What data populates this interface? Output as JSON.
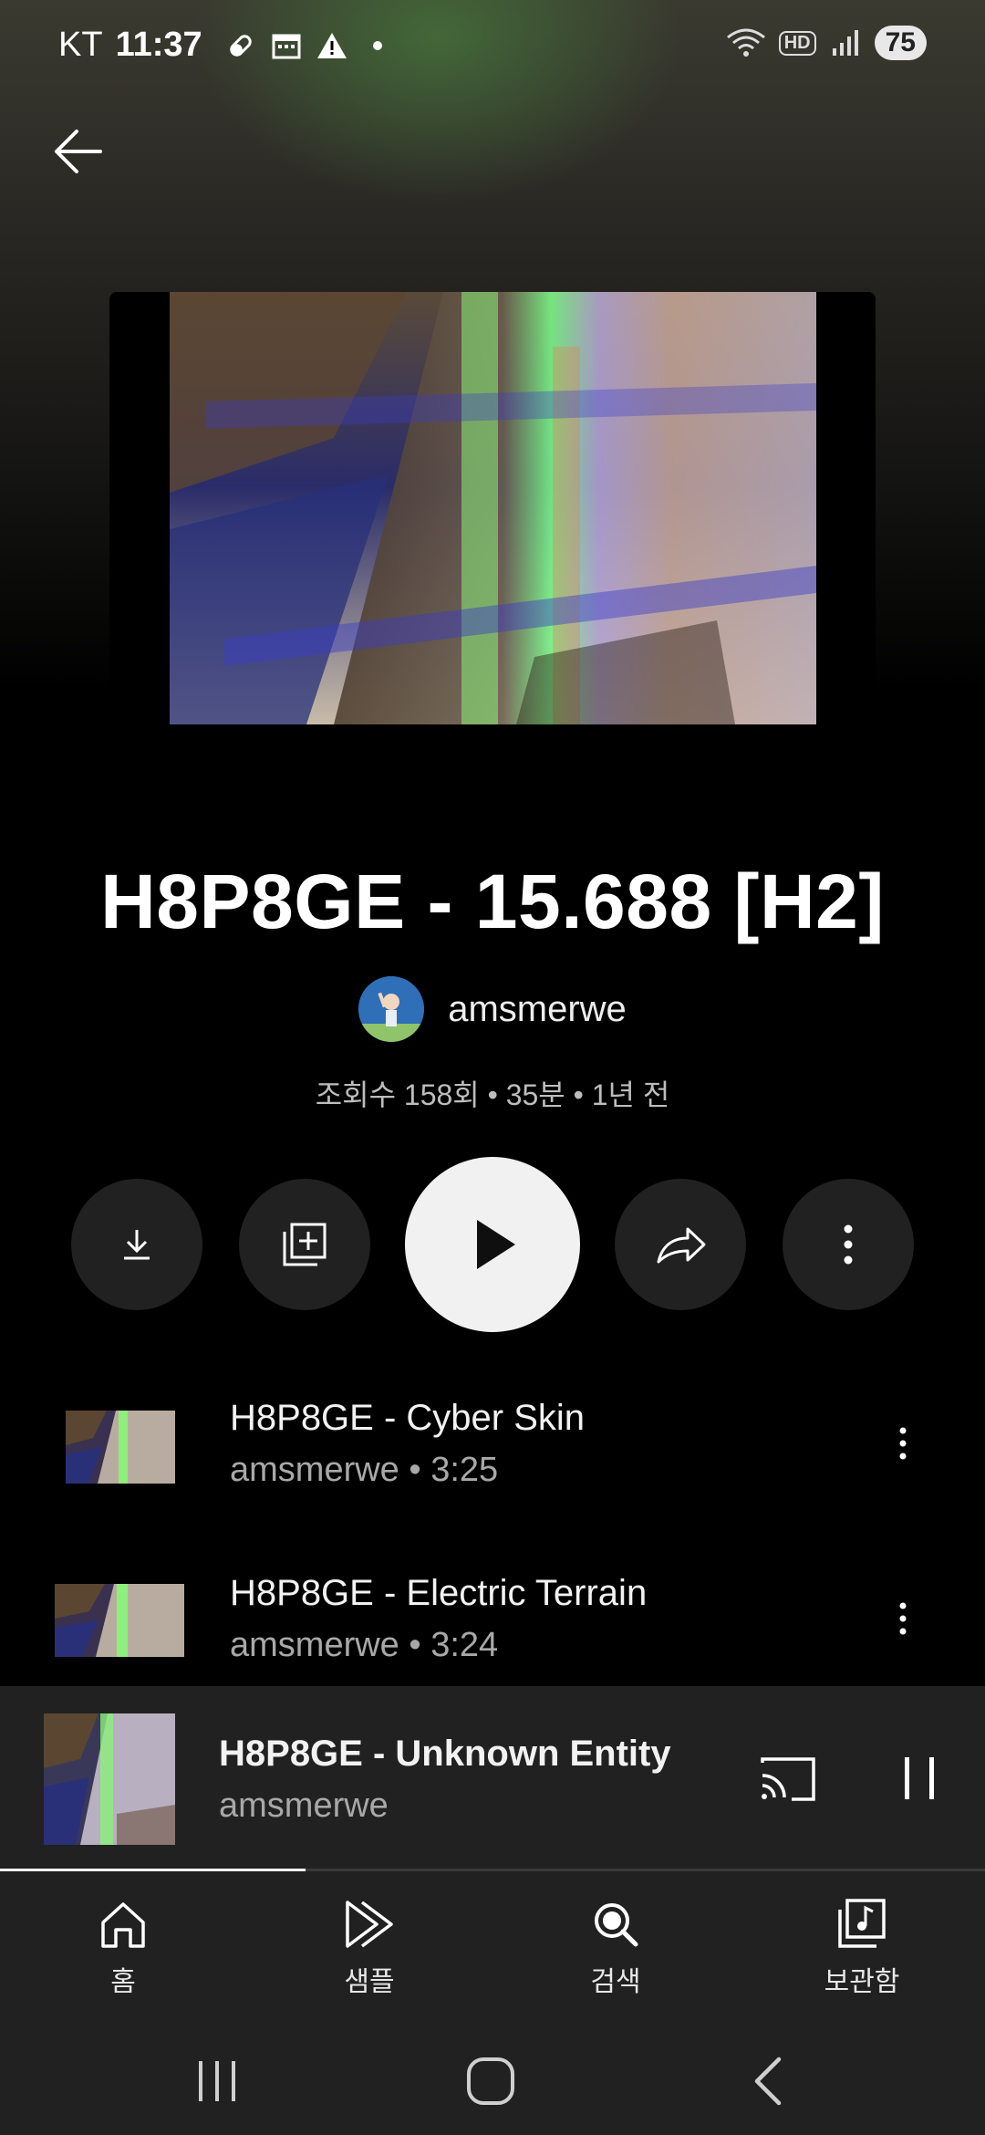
{
  "status_bar": {
    "carrier": "KT",
    "time": "11:37",
    "battery": "75",
    "hd_label": "HD"
  },
  "album": {
    "title": "H8P8GE - 15.688 [H2]",
    "channel": "amsmerwe",
    "meta": "조회수 158회 • 35분 • 1년 전"
  },
  "actions": {
    "download": "download-icon",
    "save": "add-to-playlist-icon",
    "play": "play-icon",
    "share": "share-icon",
    "more": "more-vert-icon"
  },
  "tracks": [
    {
      "title": "H8P8GE - Cyber Skin",
      "subtitle": "amsmerwe • 3:25"
    },
    {
      "title": "H8P8GE - Electric Terrain",
      "subtitle": "amsmerwe • 3:24"
    }
  ],
  "mini_player": {
    "title": "H8P8GE - Unknown Entity",
    "artist": "amsmerwe",
    "progress": 0.31
  },
  "bottom_nav": [
    {
      "label": "홈",
      "icon": "home-icon"
    },
    {
      "label": "샘플",
      "icon": "samples-icon"
    },
    {
      "label": "검색",
      "icon": "search-icon"
    },
    {
      "label": "보관함",
      "icon": "library-icon"
    }
  ],
  "colors": {
    "background": "#000000",
    "surface": "#212121",
    "text_secondary": "#a8a8a8",
    "play_button": "#f1f1f1"
  }
}
